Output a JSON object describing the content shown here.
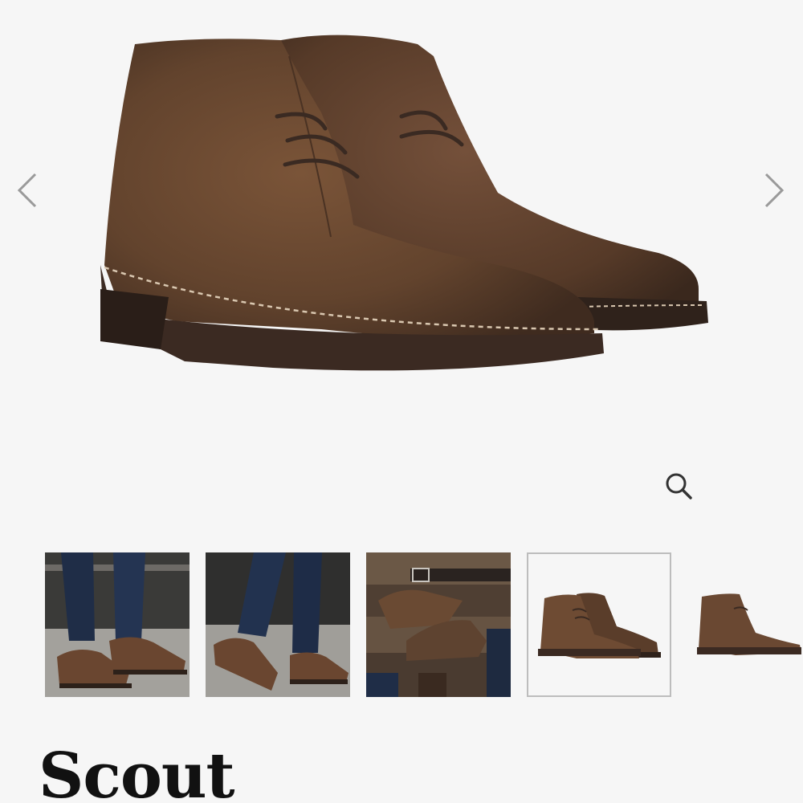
{
  "product": {
    "title": "Scout"
  },
  "gallery": {
    "prev_icon": "chevron-left-icon",
    "next_icon": "chevron-right-icon",
    "zoom_icon": "zoom-magnifier-icon",
    "active_index": 3,
    "thumbnails": [
      {
        "subject": "boots-worn-standing"
      },
      {
        "subject": "boots-worn-walking"
      },
      {
        "subject": "boots-flatlay-accessories"
      },
      {
        "subject": "boots-pair-side"
      },
      {
        "subject": "boot-single-side"
      }
    ]
  },
  "colors": {
    "background": "#f6f6f6",
    "suede": "#6b4a33",
    "sole": "#3b2a22",
    "active_border": "#bdbdbd",
    "arrow": "#9a9a9a"
  }
}
